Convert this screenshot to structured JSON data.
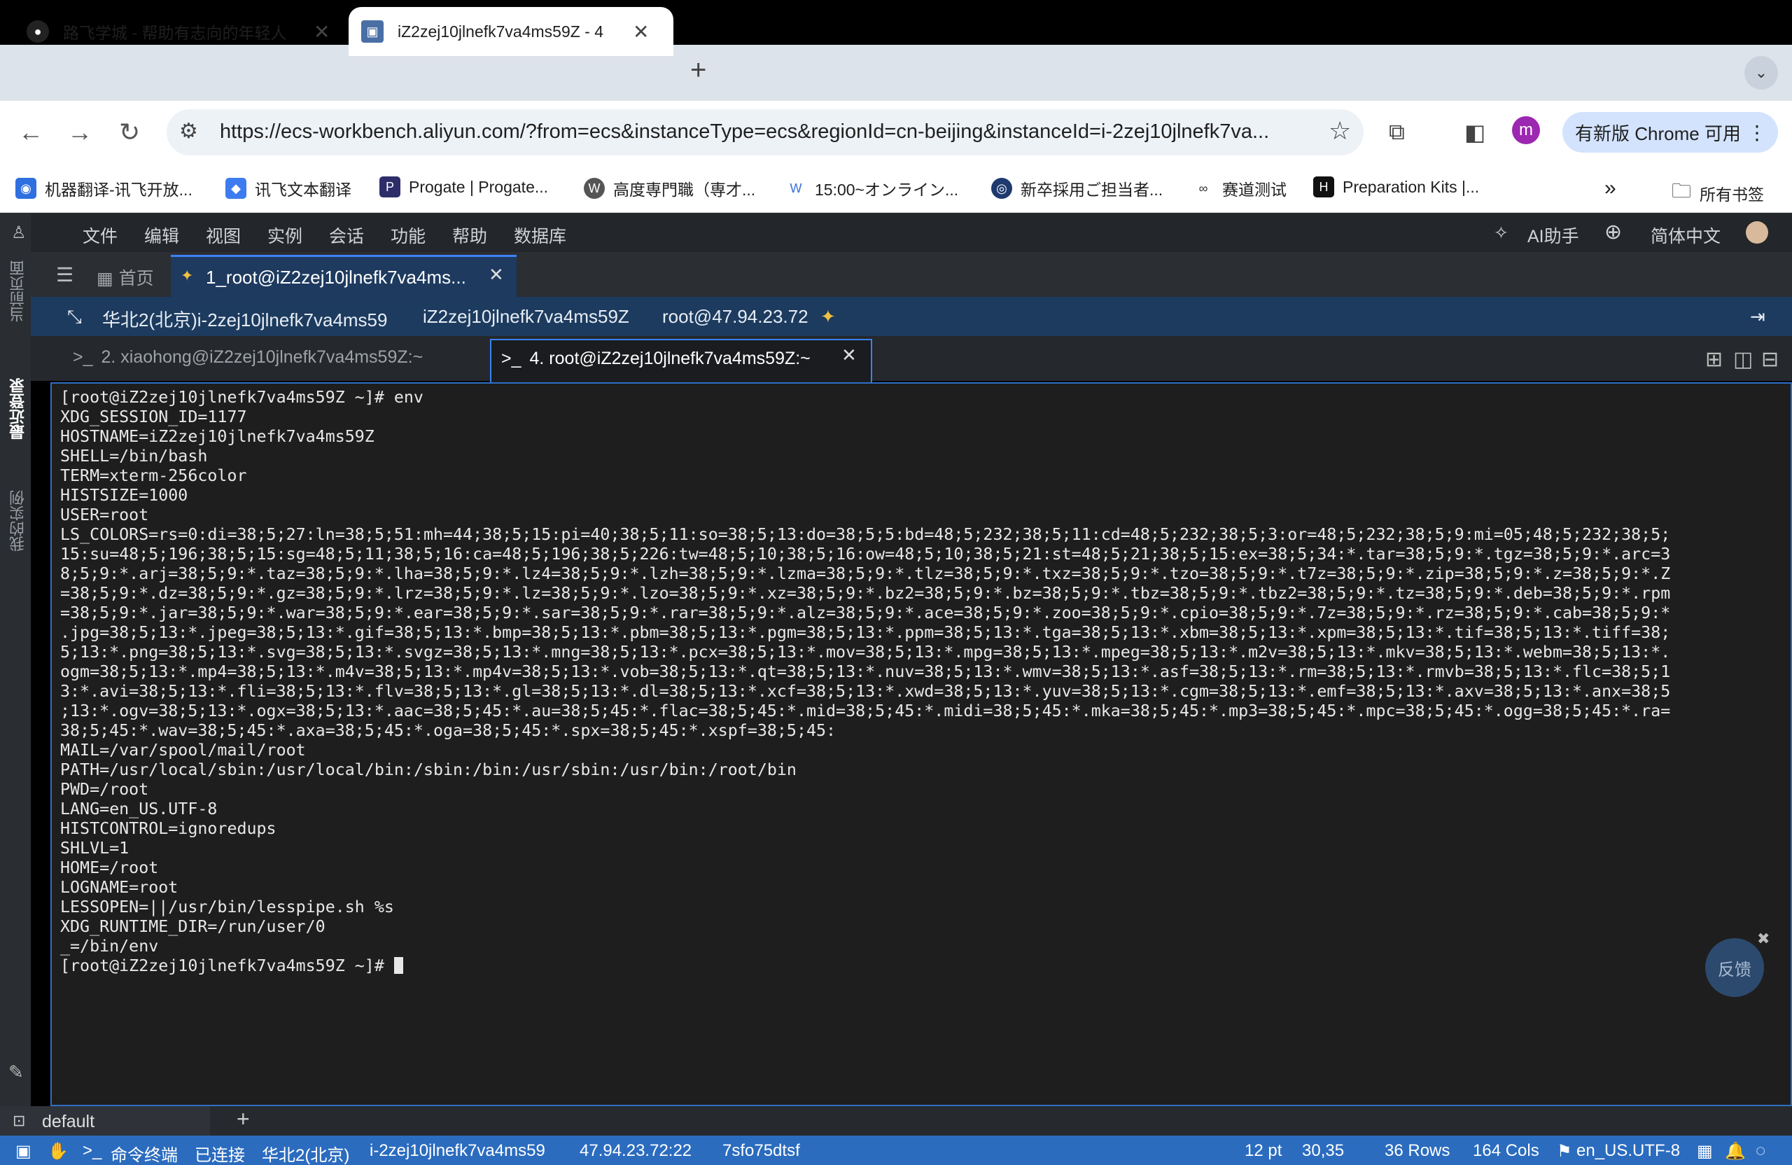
{
  "browser": {
    "tabs": [
      {
        "title": "路飞学城 - 帮助有志向的年轻人"
      },
      {
        "title": "iZ2zej10jlnefk7va4ms59Z - 4"
      }
    ],
    "url": "https://ecs-workbench.aliyun.com/?from=ecs&instanceType=ecs&regionId=cn-beijing&instanceId=i-2zej10jlnefk7va...",
    "profile_initial": "m",
    "update_label": "有新版 Chrome 可用",
    "bookmarks": [
      "机器翻译-讯飞开放...",
      "讯飞文本翻译",
      "Progate | Progate...",
      "高度専門職（専才...",
      "15:00~オンライン...",
      "新卒採用ご担当者...",
      "赛道测试",
      "Preparation Kits |..."
    ],
    "all_bookmarks": "所有书签"
  },
  "workbench": {
    "rail": {
      "current_page": "当前页面",
      "recent_login": "最近登录",
      "my_instances": "我的实例"
    },
    "menu": [
      "文件",
      "编辑",
      "视图",
      "实例",
      "会话",
      "功能",
      "帮助",
      "数据库"
    ],
    "ai_helper": "AI助手",
    "language": "简体中文",
    "home_tab": "首页",
    "session_tab": "1_root@iZ2zej10jlnefk7va4ms...",
    "info": {
      "region_instance": "华北2(北京)i-2zej10jlnefk7va4ms59",
      "hostname": "iZ2zej10jlnefk7va4ms59Z",
      "login": "root@47.94.23.72"
    },
    "terminal_tabs": [
      {
        "label": "2. xiaohong@iZ2zej10jlnefk7va4ms59Z:~"
      },
      {
        "label": "4. root@iZ2zej10jlnefk7va4ms59Z:~"
      }
    ],
    "terminal_output": "[root@iZ2zej10jlnefk7va4ms59Z ~]# env\nXDG_SESSION_ID=1177\nHOSTNAME=iZ2zej10jlnefk7va4ms59Z\nSHELL=/bin/bash\nTERM=xterm-256color\nHISTSIZE=1000\nUSER=root\nLS_COLORS=rs=0:di=38;5;27:ln=38;5;51:mh=44;38;5;15:pi=40;38;5;11:so=38;5;13:do=38;5;5:bd=48;5;232;38;5;11:cd=48;5;232;38;5;3:or=48;5;232;38;5;9:mi=05;48;5;232;38;5;\n15:su=48;5;196;38;5;15:sg=48;5;11;38;5;16:ca=48;5;196;38;5;226:tw=48;5;10;38;5;16:ow=48;5;10;38;5;21:st=48;5;21;38;5;15:ex=38;5;34:*.tar=38;5;9:*.tgz=38;5;9:*.arc=3\n8;5;9:*.arj=38;5;9:*.taz=38;5;9:*.lha=38;5;9:*.lz4=38;5;9:*.lzh=38;5;9:*.lzma=38;5;9:*.tlz=38;5;9:*.txz=38;5;9:*.tzo=38;5;9:*.t7z=38;5;9:*.zip=38;5;9:*.z=38;5;9:*.Z\n=38;5;9:*.dz=38;5;9:*.gz=38;5;9:*.lrz=38;5;9:*.lz=38;5;9:*.lzo=38;5;9:*.xz=38;5;9:*.bz2=38;5;9:*.bz=38;5;9:*.tbz=38;5;9:*.tbz2=38;5;9:*.tz=38;5;9:*.deb=38;5;9:*.rpm\n=38;5;9:*.jar=38;5;9:*.war=38;5;9:*.ear=38;5;9:*.sar=38;5;9:*.rar=38;5;9:*.alz=38;5;9:*.ace=38;5;9:*.zoo=38;5;9:*.cpio=38;5;9:*.7z=38;5;9:*.rz=38;5;9:*.cab=38;5;9:*\n.jpg=38;5;13:*.jpeg=38;5;13:*.gif=38;5;13:*.bmp=38;5;13:*.pbm=38;5;13:*.pgm=38;5;13:*.ppm=38;5;13:*.tga=38;5;13:*.xbm=38;5;13:*.xpm=38;5;13:*.tif=38;5;13:*.tiff=38;\n5;13:*.png=38;5;13:*.svg=38;5;13:*.svgz=38;5;13:*.mng=38;5;13:*.pcx=38;5;13:*.mov=38;5;13:*.mpg=38;5;13:*.mpeg=38;5;13:*.m2v=38;5;13:*.mkv=38;5;13:*.webm=38;5;13:*.\nogm=38;5;13:*.mp4=38;5;13:*.m4v=38;5;13:*.mp4v=38;5;13:*.vob=38;5;13:*.qt=38;5;13:*.nuv=38;5;13:*.wmv=38;5;13:*.asf=38;5;13:*.rm=38;5;13:*.rmvb=38;5;13:*.flc=38;5;1\n3:*.avi=38;5;13:*.fli=38;5;13:*.flv=38;5;13:*.gl=38;5;13:*.dl=38;5;13:*.xcf=38;5;13:*.xwd=38;5;13:*.yuv=38;5;13:*.cgm=38;5;13:*.emf=38;5;13:*.axv=38;5;13:*.anx=38;5\n;13:*.ogv=38;5;13:*.ogx=38;5;13:*.aac=38;5;45:*.au=38;5;45:*.flac=38;5;45:*.mid=38;5;45:*.midi=38;5;45:*.mka=38;5;45:*.mp3=38;5;45:*.mpc=38;5;45:*.ogg=38;5;45:*.ra=\n38;5;45:*.wav=38;5;45:*.axa=38;5;45:*.oga=38;5;45:*.spx=38;5;45:*.xspf=38;5;45:\nMAIL=/var/spool/mail/root\nPATH=/usr/local/sbin:/usr/local/bin:/sbin:/bin:/usr/sbin:/usr/bin:/root/bin\nPWD=/root\nLANG=en_US.UTF-8\nHISTCONTROL=ignoredups\nSHLVL=1\nHOME=/root\nLOGNAME=root\nLESSOPEN=||/usr/bin/lesspipe.sh %s\nXDG_RUNTIME_DIR=/run/user/0\n_=/bin/env\n[root@iZ2zej10jlnefk7va4ms59Z ~]# ",
    "feedback_label": "反馈",
    "session_name": "default",
    "status": {
      "terminal": "命令终端",
      "connected": "已连接",
      "region": "华北2(北京)",
      "instance_id": "i-2zej10jlnefk7va4ms59",
      "address": "47.94.23.72:22",
      "session_code": "7sfo75dtsf",
      "font_size": "12 pt",
      "cursor_pos": "30,35",
      "rows": "36 Rows",
      "cols": "164 Cols",
      "encoding": "en_US.UTF-8"
    }
  },
  "colors": {
    "accent": "#3b82f6",
    "statusbar": "#2b6cbf",
    "infobar": "#1d3b5e",
    "terminal_bg": "#1e1e1e"
  }
}
